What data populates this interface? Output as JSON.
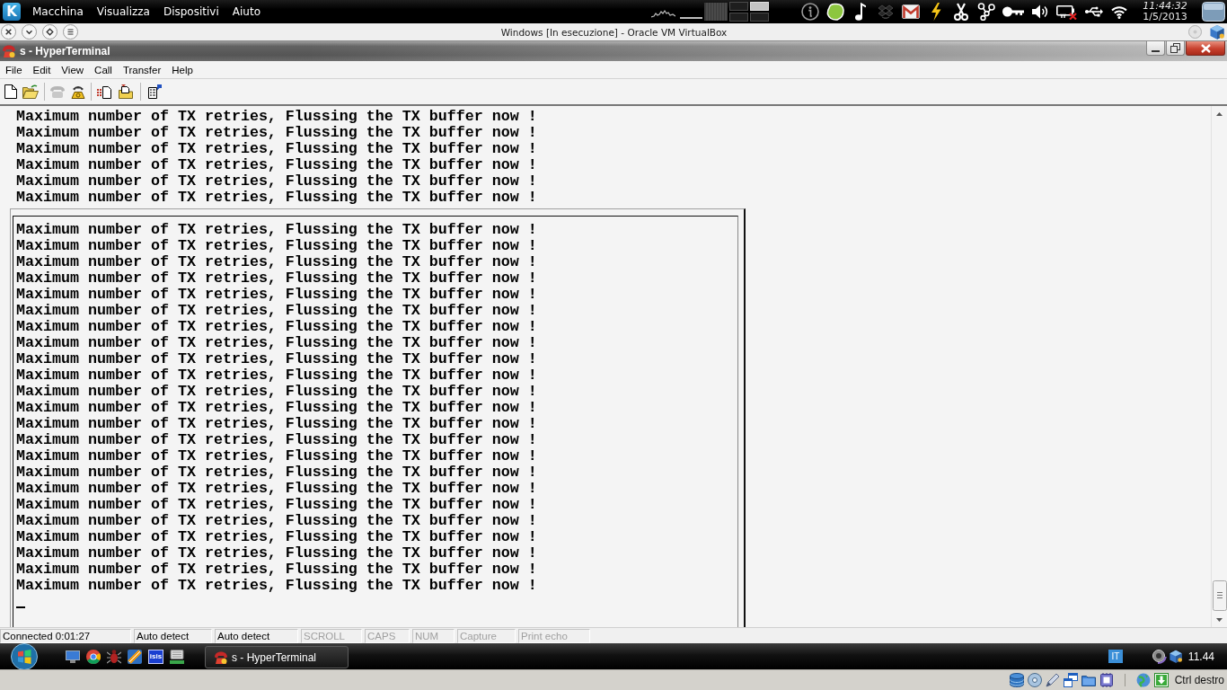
{
  "top_panel": {
    "launcher": "K",
    "menu": [
      "Macchina",
      "Visualizza",
      "Dispositivi",
      "Aiuto"
    ],
    "pager": [
      {
        "selected": false
      },
      {
        "selected": true
      },
      {
        "selected": false
      },
      {
        "selected": false
      }
    ],
    "clock": {
      "time": "11:44:32",
      "date": "1/5/2013"
    }
  },
  "vm_window": {
    "title": "Windows [In esecuzione] - Oracle VM VirtualBox"
  },
  "hyperterminal": {
    "title": "s - HyperTerminal",
    "menu": [
      "File",
      "Edit",
      "View",
      "Call",
      "Transfer",
      "Help"
    ],
    "terminal": {
      "scrollback": [
        "Maximum number of TX retries, Flussing the TX buffer now !",
        "Maximum number of TX retries, Flussing the TX buffer now !",
        "Maximum number of TX retries, Flussing the TX buffer now !",
        "Maximum number of TX retries, Flussing the TX buffer now !",
        "Maximum number of TX retries, Flussing the TX buffer now !",
        "Maximum number of TX retries, Flussing the TX buffer now !"
      ],
      "screen": [
        "Maximum number of TX retries, Flussing the TX buffer now !",
        "Maximum number of TX retries, Flussing the TX buffer now !",
        "Maximum number of TX retries, Flussing the TX buffer now !",
        "Maximum number of TX retries, Flussing the TX buffer now !",
        "Maximum number of TX retries, Flussing the TX buffer now !",
        "Maximum number of TX retries, Flussing the TX buffer now !",
        "Maximum number of TX retries, Flussing the TX buffer now !",
        "Maximum number of TX retries, Flussing the TX buffer now !",
        "Maximum number of TX retries, Flussing the TX buffer now !",
        "Maximum number of TX retries, Flussing the TX buffer now !",
        "Maximum number of TX retries, Flussing the TX buffer now !",
        "Maximum number of TX retries, Flussing the TX buffer now !",
        "Maximum number of TX retries, Flussing the TX buffer now !",
        "Maximum number of TX retries, Flussing the TX buffer now !",
        "Maximum number of TX retries, Flussing the TX buffer now !",
        "Maximum number of TX retries, Flussing the TX buffer now !",
        "Maximum number of TX retries, Flussing the TX buffer now !",
        "Maximum number of TX retries, Flussing the TX buffer now !",
        "Maximum number of TX retries, Flussing the TX buffer now !",
        "Maximum number of TX retries, Flussing the TX buffer now !",
        "Maximum number of TX retries, Flussing the TX buffer now !",
        "Maximum number of TX retries, Flussing the TX buffer now !",
        "Maximum number of TX retries, Flussing the TX buffer now !"
      ]
    },
    "status_bar": [
      {
        "text": "Connected 0:01:27",
        "disabled": false
      },
      {
        "text": "Auto detect",
        "disabled": false
      },
      {
        "text": "Auto detect",
        "disabled": false
      },
      {
        "text": "SCROLL",
        "disabled": true
      },
      {
        "text": "CAPS",
        "disabled": true
      },
      {
        "text": "NUM",
        "disabled": true
      },
      {
        "text": "Capture",
        "disabled": true
      },
      {
        "text": "Print echo",
        "disabled": true
      }
    ]
  },
  "taskbar": {
    "app_tile": "isis",
    "tasks": [
      {
        "label": "s - HyperTerminal"
      }
    ],
    "language": "IT",
    "clock": "11.44"
  },
  "vm_status_bar": {
    "host_key": "Ctrl destro"
  }
}
